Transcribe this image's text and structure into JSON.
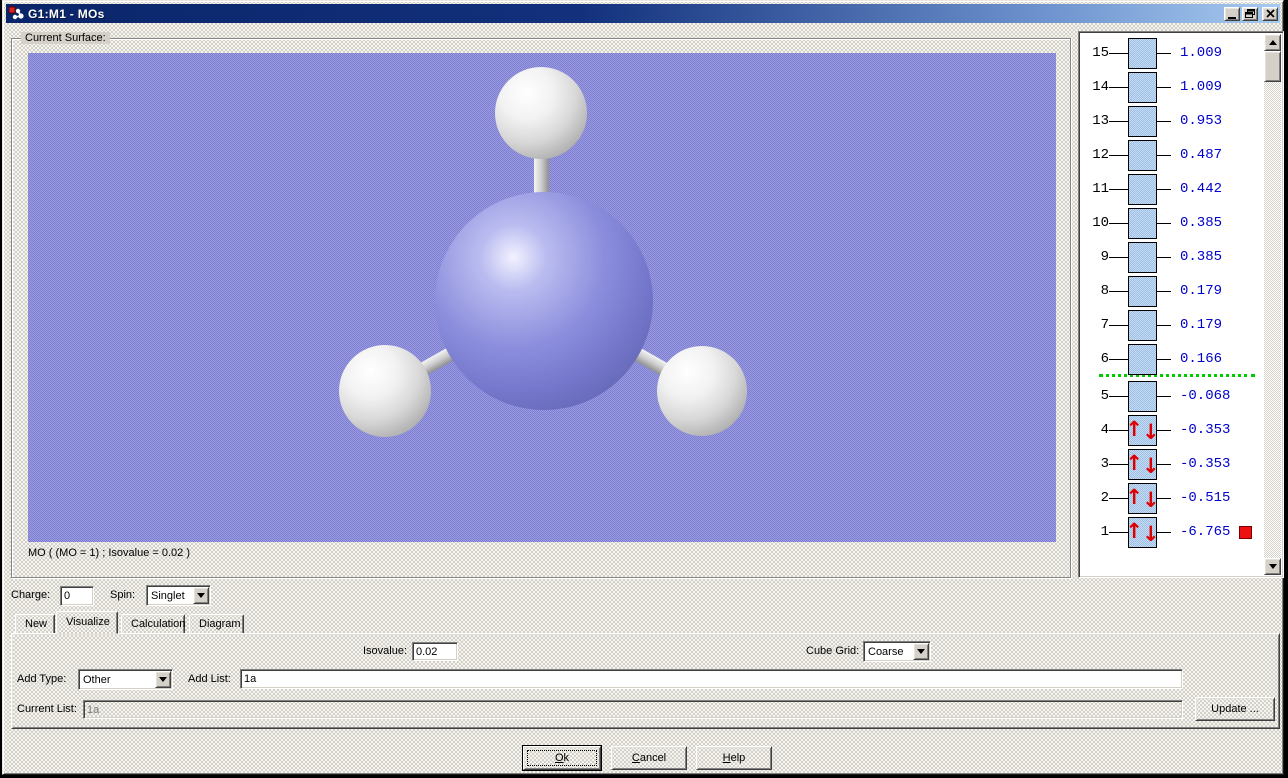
{
  "window": {
    "title": "G1:M1 - MOs"
  },
  "surface_group": {
    "label": "Current Surface:",
    "caption": "MO ( (MO = 1) ; Isovalue = 0.02 )"
  },
  "mo_panel": {
    "separator_after_index": 6,
    "selected_index": 1,
    "orbitals": [
      {
        "index": 15,
        "energy": "1.009",
        "occupied": false,
        "selected": false
      },
      {
        "index": 14,
        "energy": "1.009",
        "occupied": false,
        "selected": false
      },
      {
        "index": 13,
        "energy": "0.953",
        "occupied": false,
        "selected": false
      },
      {
        "index": 12,
        "energy": "0.487",
        "occupied": false,
        "selected": false
      },
      {
        "index": 11,
        "energy": "0.442",
        "occupied": false,
        "selected": false
      },
      {
        "index": 10,
        "energy": "0.385",
        "occupied": false,
        "selected": false
      },
      {
        "index": 9,
        "energy": "0.385",
        "occupied": false,
        "selected": false
      },
      {
        "index": 8,
        "energy": "0.179",
        "occupied": false,
        "selected": false
      },
      {
        "index": 7,
        "energy": "0.179",
        "occupied": false,
        "selected": false
      },
      {
        "index": 6,
        "energy": "0.166",
        "occupied": false,
        "selected": false
      },
      {
        "index": 5,
        "energy": "-0.068",
        "occupied": false,
        "selected": false
      },
      {
        "index": 4,
        "energy": "-0.353",
        "occupied": true,
        "selected": false
      },
      {
        "index": 3,
        "energy": "-0.353",
        "occupied": true,
        "selected": false
      },
      {
        "index": 2,
        "energy": "-0.515",
        "occupied": true,
        "selected": false
      },
      {
        "index": 1,
        "energy": "-6.765",
        "occupied": true,
        "selected": true
      }
    ]
  },
  "controls": {
    "charge_label": "Charge:",
    "charge_value": "0",
    "spin_label": "Spin:",
    "spin_value": "Singlet"
  },
  "tabs": [
    {
      "label": "New"
    },
    {
      "label": "Visualize"
    },
    {
      "label": "Calculation"
    },
    {
      "label": "Diagram"
    }
  ],
  "visualize_tab": {
    "isovalue_label": "Isovalue:",
    "isovalue_value": "0.02",
    "cube_grid_label": "Cube Grid:",
    "cube_grid_value": "Coarse",
    "add_type_label": "Add Type:",
    "add_type_value": "Other",
    "add_list_label": "Add List:",
    "add_list_value": "1a",
    "current_list_label": "Current List:",
    "current_list_value": "1a",
    "update_button": "Update ..."
  },
  "footer": {
    "ok": "Ok",
    "cancel": "Cancel",
    "help": "Help"
  },
  "colors": {
    "titlebar_start": "#0a2569",
    "titlebar_end": "#a8cbf0",
    "viewport_bg": "#8c8dd6",
    "mo_energy_text": "#0000cc",
    "mo_box_fill": "#b0cceb",
    "occupied_arrow": "#dd0000",
    "homo_lumo_separator": "#00cc00",
    "selected_marker": "#ee1111"
  }
}
